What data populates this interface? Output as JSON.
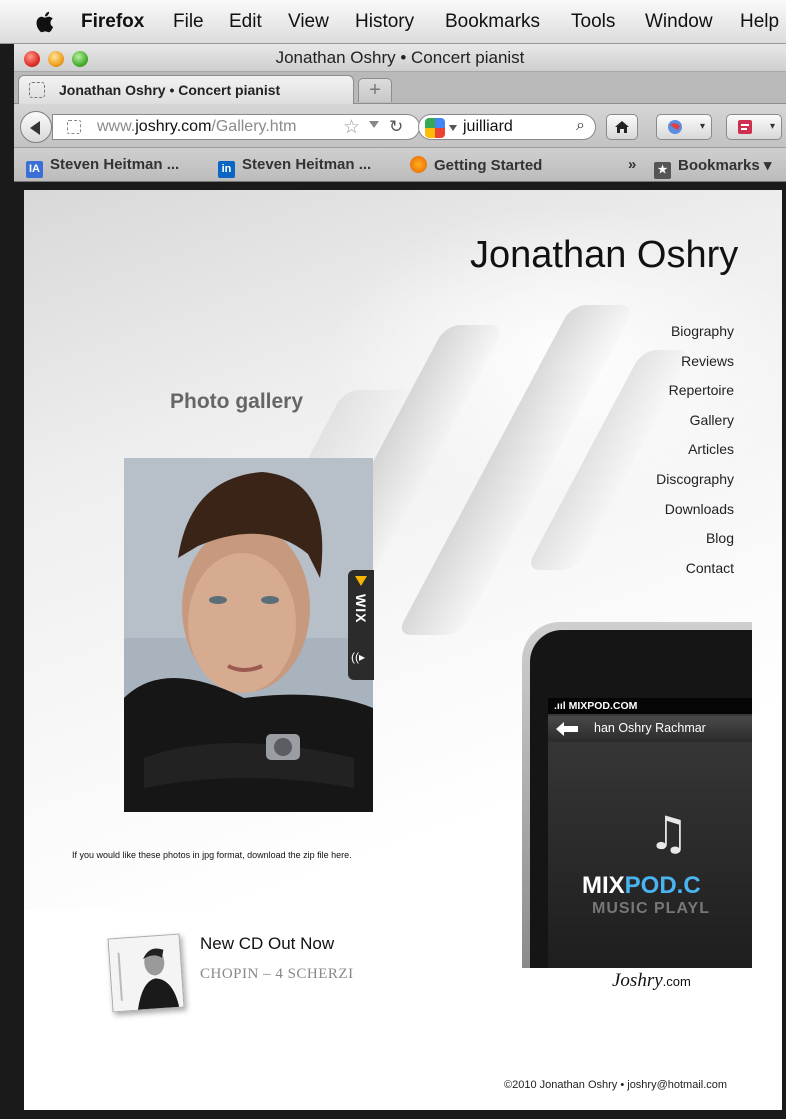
{
  "menubar": {
    "app": "Firefox",
    "items": [
      "File",
      "Edit",
      "View",
      "History",
      "Bookmarks",
      "Tools",
      "Window",
      "Help"
    ]
  },
  "window": {
    "title": "Jonathan Oshry • Concert pianist"
  },
  "tab": {
    "title": "Jonathan Oshry • Concert pianist",
    "new_tab_symbol": "+"
  },
  "toolbar": {
    "url_prefix": "www.",
    "url_domain": "joshry.com",
    "url_path": "/Gallery.htm",
    "search_query": "juilliard",
    "home_icon": "home-icon",
    "reload_icon": "reload-icon"
  },
  "bookmarks": {
    "items": [
      {
        "label": "Steven Heitman ...",
        "icon": "ia-icon",
        "color": "#3a6fd8"
      },
      {
        "label": "Steven Heitman ...",
        "icon": "linkedin-icon",
        "color": "#0a66c2"
      },
      {
        "label": "Getting Started",
        "icon": "firefox-icon",
        "color": "#e66000"
      }
    ],
    "overflow": "»",
    "menu_label": "Bookmarks"
  },
  "page": {
    "site_title": "Jonathan Oshry",
    "section_heading": "Photo gallery",
    "nav": [
      "Biography",
      "Reviews",
      "Repertoire",
      "Gallery",
      "Articles",
      "Discography",
      "Downloads",
      "Blog",
      "Contact"
    ],
    "gallery_caption": "If you would like these photos in jpg format, download the zip file here.",
    "wix_label": "WIX",
    "cd": {
      "title": "New CD Out Now",
      "subtitle": "CHOPIN – 4 SCHERZI"
    },
    "player": {
      "status": ".ııl MIXPOD.COM",
      "track": "han Oshry  Rachmar",
      "brand_a": "MIX",
      "brand_b": "POD.C",
      "tagline": "MUSIC PLAYL"
    },
    "signature": "Joshry",
    "signature_suffix": ".com",
    "footer": "©2010 Jonathan Oshry • joshry@hotmail.com"
  }
}
